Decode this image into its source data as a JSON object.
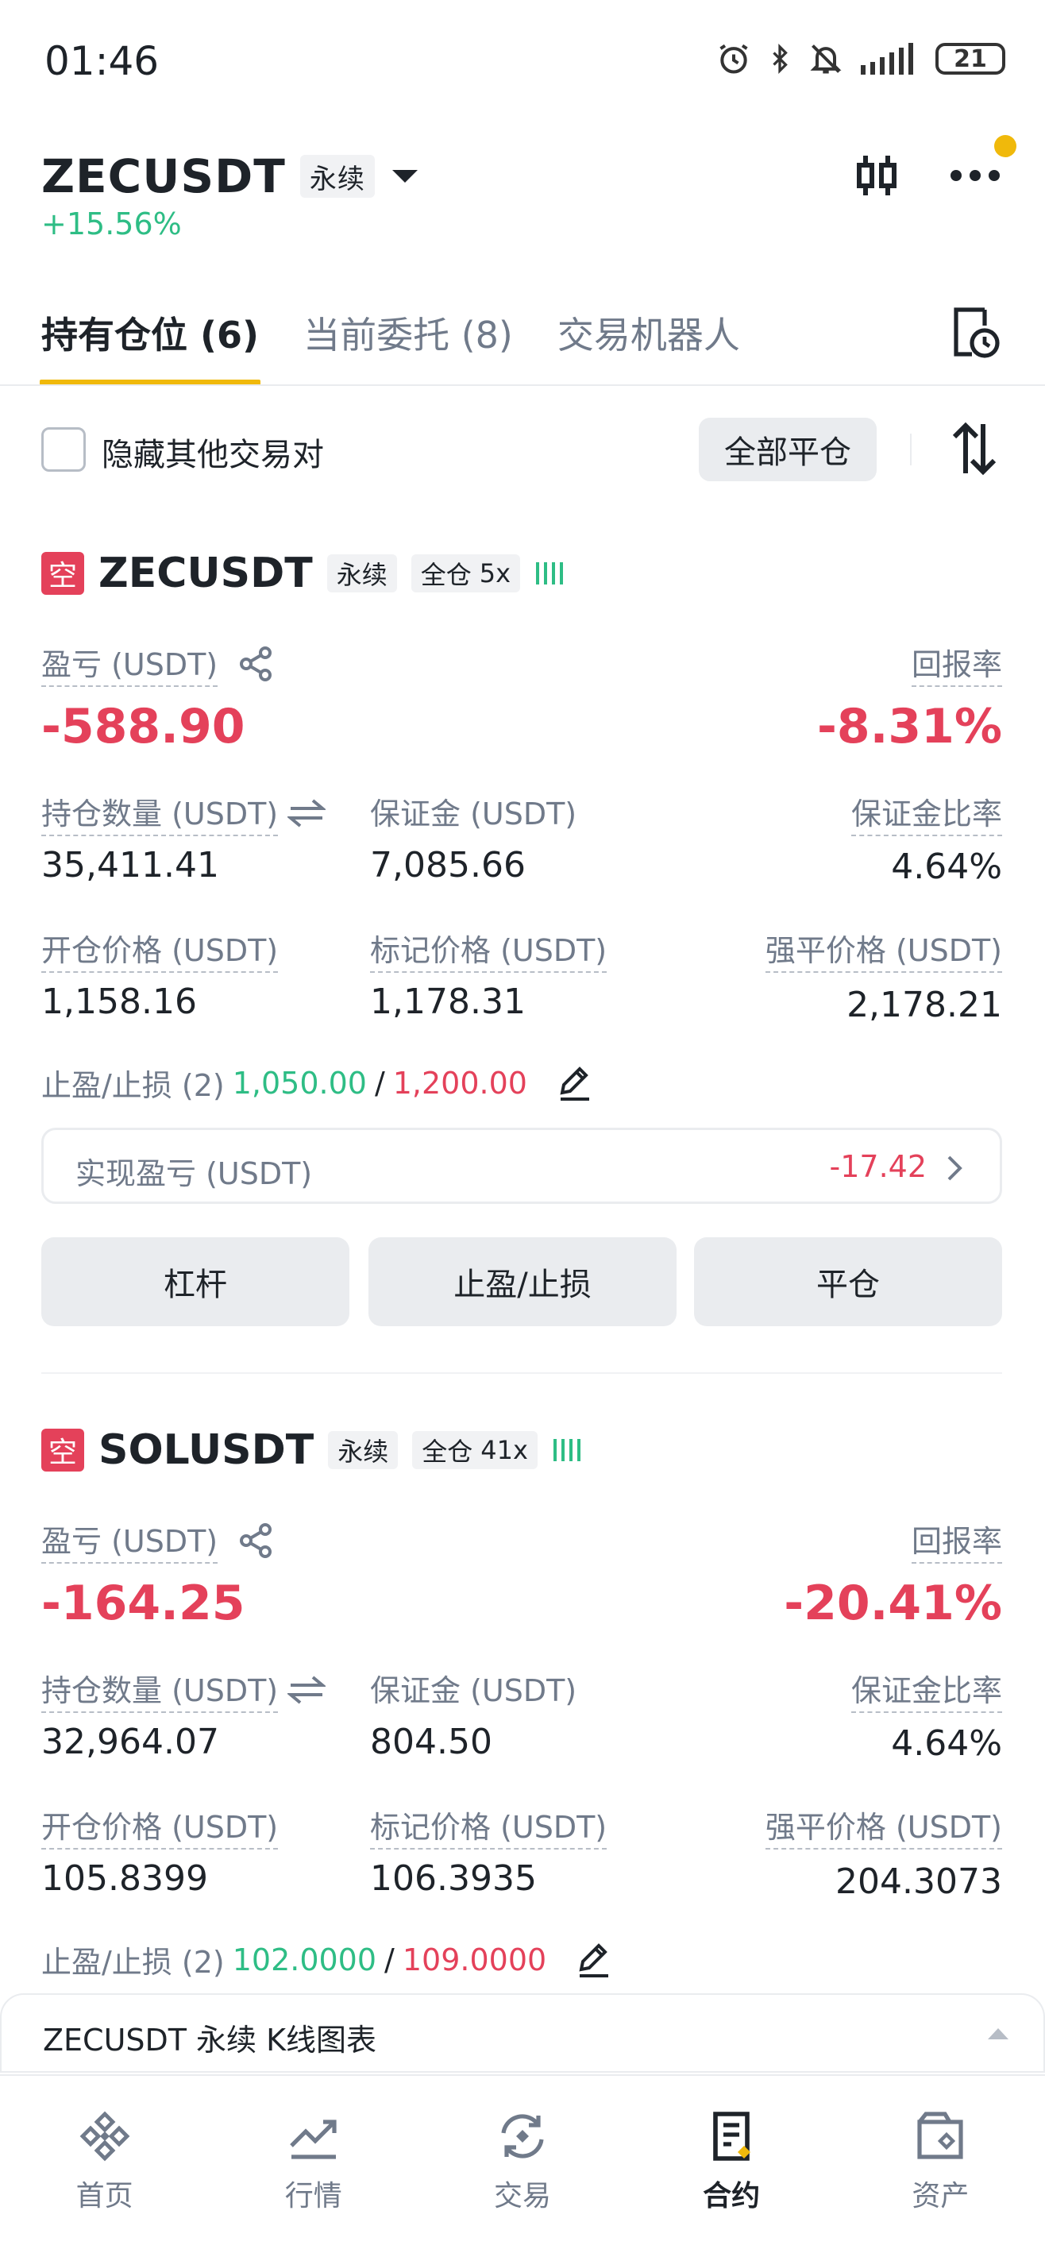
{
  "status_bar": {
    "time": "01:46",
    "battery": "21"
  },
  "header": {
    "pair": "ZECUSDT",
    "type": "永续",
    "change": "+15.56%"
  },
  "tabs": [
    {
      "label": "持有仓位 (6)"
    },
    {
      "label": "当前委托 (8)"
    },
    {
      "label": "交易机器人"
    }
  ],
  "filter": {
    "hide_label": "隐藏其他交易对",
    "close_all": "全部平仓"
  },
  "positions": [
    {
      "badge": "空",
      "symbol": "ZECUSDT",
      "type": "永续",
      "margin_mode": "全仓",
      "leverage": "5x",
      "pnl_label": "盈亏 (USDT)",
      "pnl": "-588.90",
      "roe_label": "回报率",
      "roe": "-8.31%",
      "size_label": "持仓数量 (USDT)",
      "size": "35,411.41",
      "margin_label": "保证金 (USDT)",
      "margin": "7,085.66",
      "margin_ratio_label": "保证金比率",
      "margin_ratio": "4.64%",
      "entry_label": "开仓价格 (USDT)",
      "entry": "1,158.16",
      "mark_label": "标记价格 (USDT)",
      "mark": "1,178.31",
      "liq_label": "强平价格 (USDT)",
      "liq": "2,178.21",
      "tpsl_label": "止盈/止损 (2)",
      "tp": "1,050.00",
      "sl": "1,200.00",
      "realized_label": "实现盈亏 (USDT)",
      "realized": "-17.42",
      "buttons": [
        "杠杆",
        "止盈/止损",
        "平仓"
      ]
    },
    {
      "badge": "空",
      "symbol": "SOLUSDT",
      "type": "永续",
      "margin_mode": "全仓",
      "leverage": "41x",
      "pnl_label": "盈亏 (USDT)",
      "pnl": "-164.25",
      "roe_label": "回报率",
      "roe": "-20.41%",
      "size_label": "持仓数量 (USDT)",
      "size": "32,964.07",
      "margin_label": "保证金 (USDT)",
      "margin": "804.50",
      "margin_ratio_label": "保证金比率",
      "margin_ratio": "4.64%",
      "entry_label": "开仓价格 (USDT)",
      "entry": "105.8399",
      "mark_label": "标记价格 (USDT)",
      "mark": "106.3935",
      "liq_label": "强平价格 (USDT)",
      "liq": "204.3073",
      "tpsl_label": "止盈/止损 (2)",
      "tp": "102.0000",
      "sl": "109.0000"
    }
  ],
  "chart_bar": {
    "label": "ZECUSDT 永续 K线图表"
  },
  "nav": [
    {
      "label": "首页",
      "icon": "binance-logo-icon"
    },
    {
      "label": "行情",
      "icon": "market-chart-icon"
    },
    {
      "label": "交易",
      "icon": "trade-icon"
    },
    {
      "label": "合约",
      "icon": "futures-icon"
    },
    {
      "label": "资产",
      "icon": "wallet-icon"
    }
  ]
}
